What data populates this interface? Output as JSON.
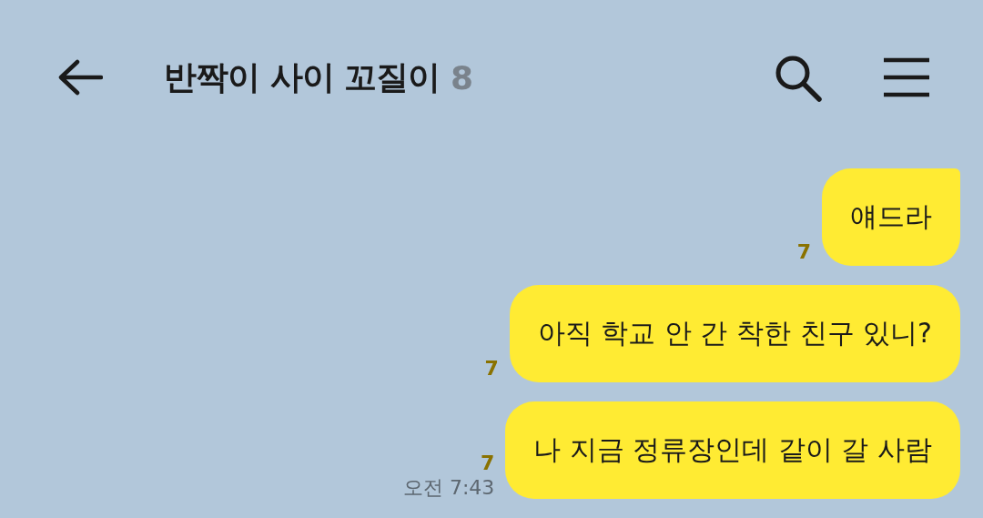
{
  "header": {
    "title": "반짝이 사이 꼬질이",
    "member_count": "8"
  },
  "messages": [
    {
      "text": "얘드라",
      "unread": "7",
      "tail": true
    },
    {
      "text": "아직 학교 안 간 착한 친구 있니?",
      "unread": "7",
      "tail": false
    },
    {
      "text": "나 지금 정류장인데 같이 갈 사람",
      "unread": "7",
      "tail": false,
      "time": "오전 7:43"
    }
  ]
}
